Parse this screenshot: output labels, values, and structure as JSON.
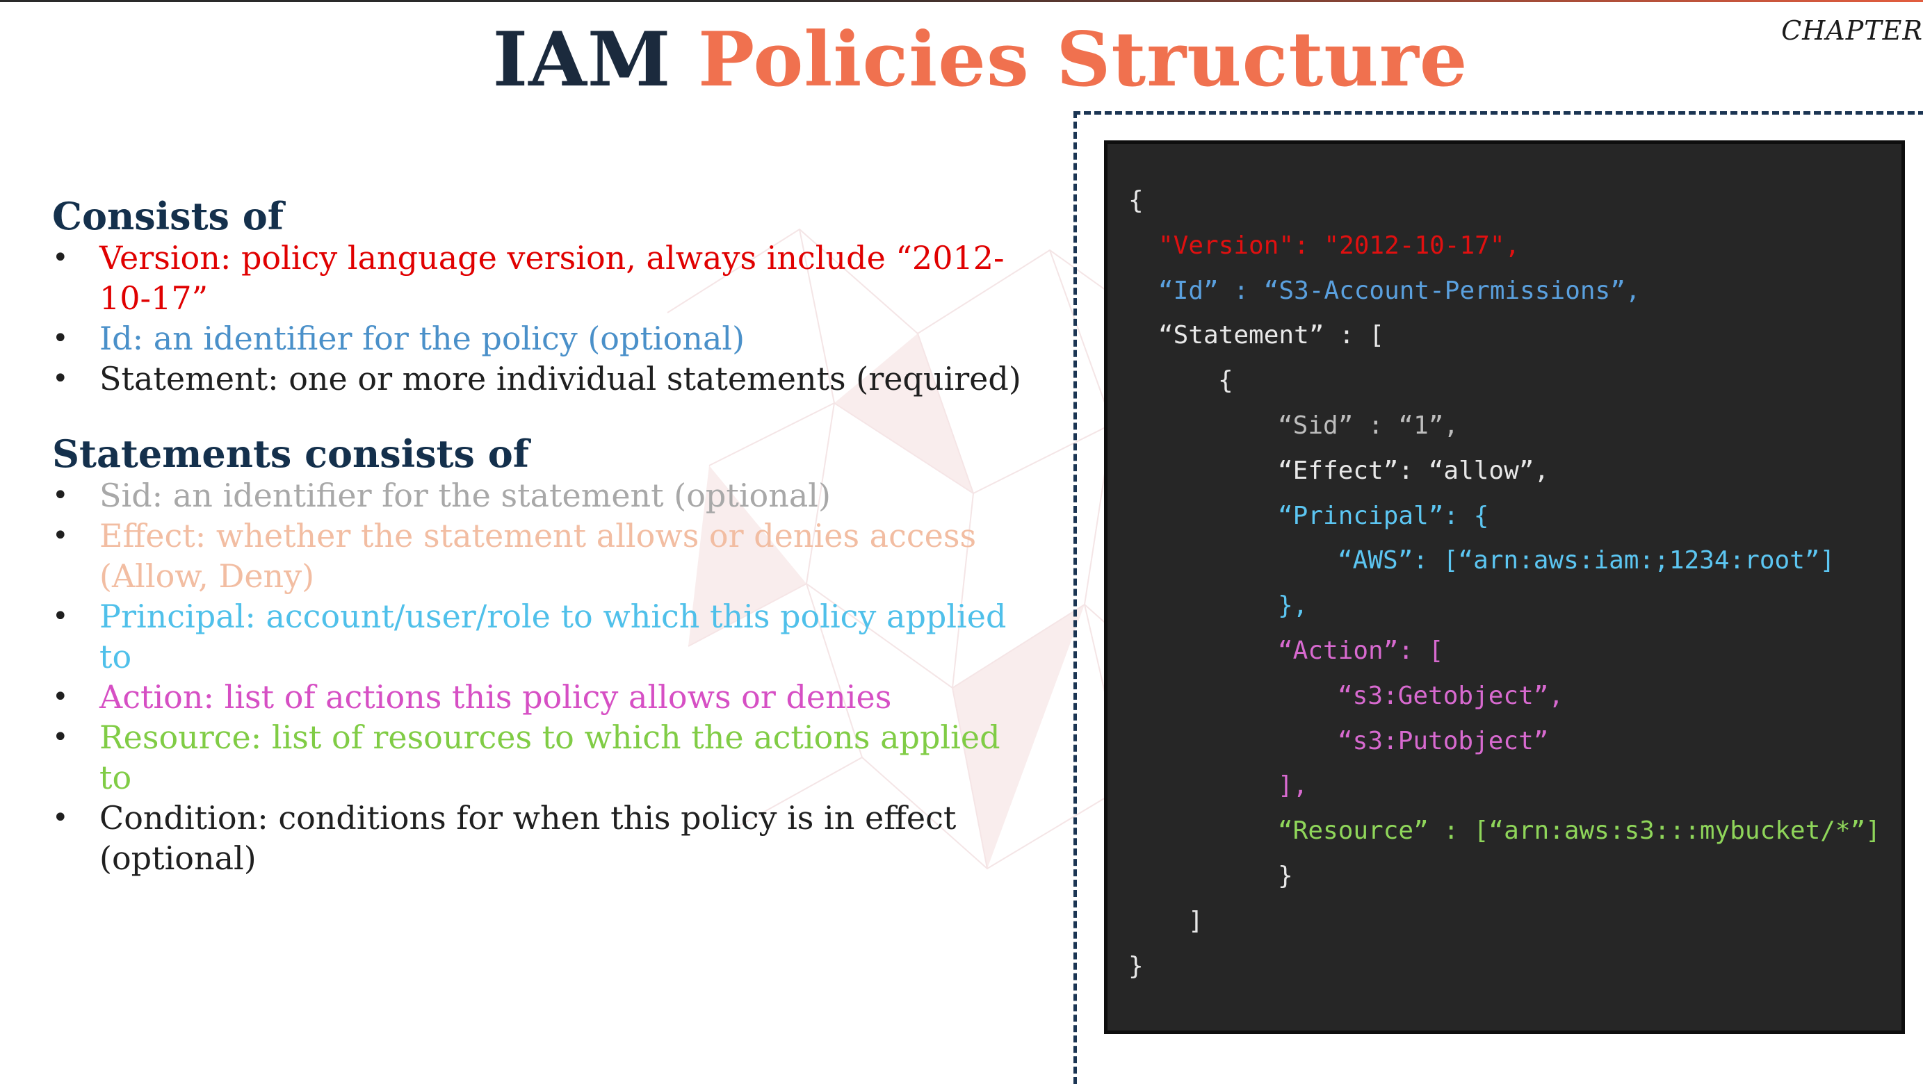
{
  "colors": {
    "title_dark": "#1b2a3d",
    "title_accent": "#f0714f",
    "heading": "#14304c",
    "version": "#e00000",
    "id": "#4a90c9",
    "statement": "#1f1f1f",
    "sid": "#a8a8a8",
    "effect": "#f2bda2",
    "principal": "#4fc0ea",
    "action": "#d64fc4",
    "resource": "#80cc45",
    "condition": "#1f1f1f",
    "code_bg": "#262626",
    "code_default": "#e8e8e8",
    "code_version": "#e01010",
    "code_id": "#5aa0de",
    "code_sid": "#bdbdbd",
    "code_principal": "#5cc6f2",
    "code_action": "#d86ad0",
    "code_resource": "#8fd65a"
  },
  "slide": {
    "title_part1": "IAM",
    "title_part2": "Policies Structure",
    "chapter_label": "CHAPTER"
  },
  "left": {
    "consists_heading": "Consists of",
    "consists_items": [
      {
        "text": "Version: policy language version, always include “2012-10-17”",
        "color_key": "version"
      },
      {
        "text": "Id: an identifier for the policy (optional)",
        "color_key": "id"
      },
      {
        "text": "Statement: one or more individual statements (required)",
        "color_key": "statement"
      }
    ],
    "statements_heading": "Statements consists of",
    "statement_items": [
      {
        "text": "Sid: an identifier for the statement (optional)",
        "color_key": "sid"
      },
      {
        "text": "Effect: whether the statement allows or denies access (Allow, Deny)",
        "color_key": "effect"
      },
      {
        "text": "Principal: account/user/role to which this policy applied to",
        "color_key": "principal"
      },
      {
        "text": "Action: list of actions this policy allows or denies",
        "color_key": "action"
      },
      {
        "text": "Resource: list of resources to which the actions applied to",
        "color_key": "resource"
      },
      {
        "text": "Condition: conditions for when this policy is in effect (optional)",
        "color_key": "condition"
      }
    ]
  },
  "code": {
    "lines": [
      {
        "indent": 0,
        "text": "{",
        "color_key": "code_default"
      },
      {
        "indent": 1,
        "text": "\"Version\": \"2012-10-17\",",
        "color_key": "code_version"
      },
      {
        "indent": 1,
        "text": "“Id” : “S3-Account-Permissions”,",
        "color_key": "code_id"
      },
      {
        "indent": 1,
        "text": "“Statement” : [",
        "color_key": "code_default"
      },
      {
        "indent": 3,
        "text": "{",
        "color_key": "code_default"
      },
      {
        "indent": 5,
        "text": "“Sid” : “1”,",
        "color_key": "code_sid"
      },
      {
        "indent": 5,
        "text": "“Effect”: “allow”,",
        "color_key": "code_default"
      },
      {
        "indent": 5,
        "text": "“Principal”: {",
        "color_key": "code_principal"
      },
      {
        "indent": 7,
        "text": "“AWS”: [“arn:aws:iam:;1234:root”]",
        "color_key": "code_principal"
      },
      {
        "indent": 5,
        "text": "},",
        "color_key": "code_principal"
      },
      {
        "indent": 5,
        "text": "“Action”: [",
        "color_key": "code_action"
      },
      {
        "indent": 7,
        "text": "“s3:Getobject”,",
        "color_key": "code_action"
      },
      {
        "indent": 7,
        "text": "“s3:Putobject”",
        "color_key": "code_action"
      },
      {
        "indent": 5,
        "text": "],",
        "color_key": "code_action"
      },
      {
        "indent": 5,
        "text": "“Resource” : [“arn:aws:s3:::mybucket/*”]",
        "color_key": "code_resource"
      },
      {
        "indent": 5,
        "text": "}",
        "color_key": "code_default"
      },
      {
        "indent": 2,
        "text": "]",
        "color_key": "code_default"
      },
      {
        "indent": 0,
        "text": "}",
        "color_key": "code_default"
      }
    ]
  }
}
